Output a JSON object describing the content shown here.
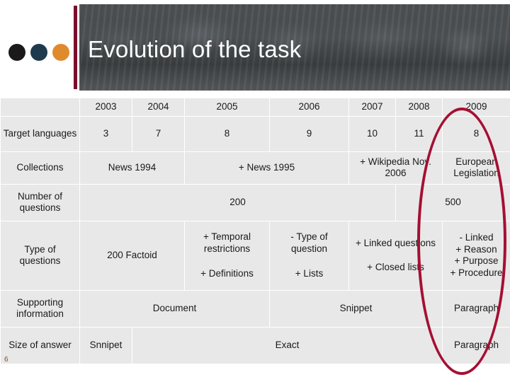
{
  "slide": {
    "title": "Evolution of the task",
    "page_number": "6"
  },
  "colors": {
    "accent_bar": "#7d0d2b",
    "row_header_bg": "#7d3a13",
    "highlight_ellipse": "#a50f33",
    "dot_black": "#1a1a1a",
    "dot_blue": "#1f3a4d",
    "dot_orange": "#e08a2e"
  },
  "table": {
    "columns": [
      "",
      "2003",
      "2004",
      "2005",
      "2006",
      "2007",
      "2008",
      "2009"
    ],
    "rows": [
      {
        "header": "Target languages",
        "cells": [
          "3",
          "7",
          "8",
          "9",
          "10",
          "11",
          "8"
        ]
      },
      {
        "header": "Collections",
        "cells": [
          "News 1994",
          "+ News 1995",
          "+ Wikipedia Nov. 2006",
          "European Legislation"
        ]
      },
      {
        "header": "Number of questions",
        "cells": [
          "200",
          "500"
        ]
      },
      {
        "header": "Type of questions",
        "cells": [
          "200 Factoid",
          {
            "top": "+ Temporal restrictions",
            "bottom": "+ Definitions"
          },
          {
            "top": "- Type of question",
            "bottom": "+ Lists"
          },
          {
            "top": "+ Linked questions",
            "bottom": "+ Closed lists"
          },
          {
            "lines": [
              "- Linked",
              "+ Reason",
              "+ Purpose",
              "+ Procedure"
            ]
          }
        ]
      },
      {
        "header": "Supporting information",
        "cells": [
          "Document",
          "Snippet",
          "Paragraph"
        ]
      },
      {
        "header": "Size of answer",
        "cells": [
          "Snnipet",
          "Exact",
          "Paragraph"
        ]
      }
    ]
  }
}
